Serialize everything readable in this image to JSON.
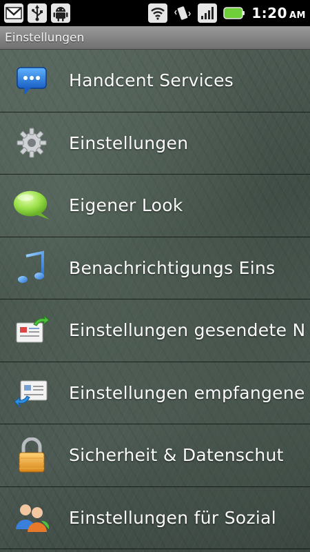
{
  "status_bar": {
    "time": "1:20",
    "ampm": "AM",
    "icons": [
      "gmail-icon",
      "usb-icon",
      "android-debug-icon",
      "wifi-icon",
      "vibrate-icon",
      "signal-icon",
      "battery-icon"
    ]
  },
  "title_bar": {
    "title": "Einstellungen"
  },
  "menu": {
    "items": [
      {
        "label": "Handcent Services",
        "icon": "chat-bubble-icon"
      },
      {
        "label": "Einstellungen",
        "icon": "gear-icon"
      },
      {
        "label": "Eigener Look",
        "icon": "green-bubble-icon"
      },
      {
        "label": "Benachrichtigungs Eins",
        "icon": "music-note-icon"
      },
      {
        "label": "Einstellungen gesendete N",
        "icon": "sent-message-icon"
      },
      {
        "label": "Einstellungen empfangene I",
        "icon": "received-message-icon"
      },
      {
        "label": "Sicherheit & Datenschut",
        "icon": "lock-icon"
      },
      {
        "label": "Einstellungen für Sozial",
        "icon": "people-icon"
      }
    ]
  }
}
